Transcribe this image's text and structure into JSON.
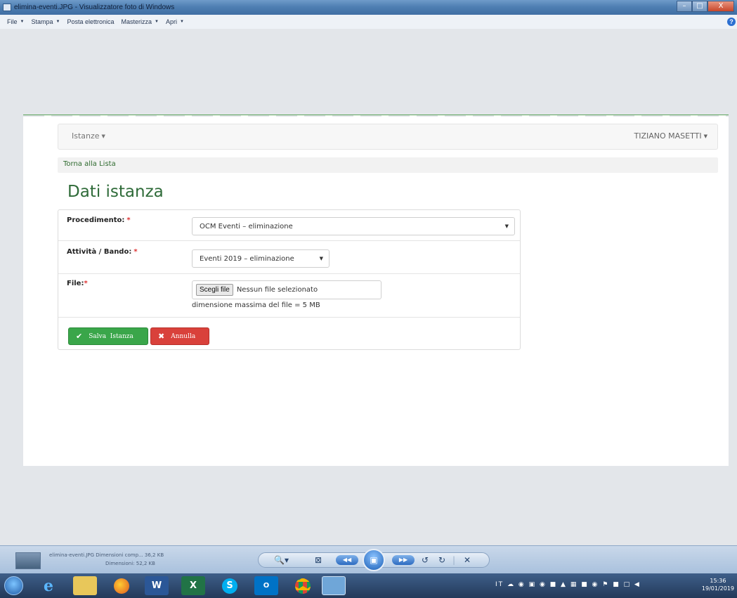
{
  "window": {
    "title": "elimina-eventi.JPG - Visualizzatore foto di Windows",
    "controls": {
      "minimize": "–",
      "maximize": "□",
      "close": "X"
    }
  },
  "menu": {
    "items": [
      {
        "label": "File",
        "has_dropdown": true
      },
      {
        "label": "Stampa",
        "has_dropdown": true
      },
      {
        "label": "Posta elettronica",
        "has_dropdown": false
      },
      {
        "label": "Masterizza",
        "has_dropdown": true
      },
      {
        "label": "Apri",
        "has_dropdown": true
      }
    ],
    "help": "?"
  },
  "page": {
    "navbar": {
      "left_menu": "Istanze",
      "user_menu": "TIZIANO MASETTI"
    },
    "back_link": "Torna alla Lista",
    "title": "Dati istanza",
    "form": {
      "procedimento": {
        "label": "Procedimento:",
        "required_mark": "*",
        "value": "OCM Eventi – eliminazione"
      },
      "attivita": {
        "label": "Attività / Bando:",
        "required_mark": "*",
        "value": "Eventi 2019 – eliminazione"
      },
      "file": {
        "label": "File:",
        "required_mark": "*",
        "button": "Scegli file",
        "status": "Nessun file selezionato",
        "hint": "dimensione massima del file = 5 MB"
      },
      "save_button": "Salva  Istanza",
      "cancel_button": "Annulla"
    }
  },
  "viewer_controls": {
    "file_info_line1": "elimina-eventi.JPG  Dimensioni comp... 36,2 KB",
    "file_info_line2": "Dimensioni: 52,2 KB"
  },
  "taskbar": {
    "language": "IT",
    "time": "15:36",
    "date": "19/01/2019"
  },
  "colors": {
    "title_green": "#2f6b39",
    "save_green": "#3aa64a",
    "cancel_red": "#d9413b",
    "taskbar": "#2d4a70"
  }
}
